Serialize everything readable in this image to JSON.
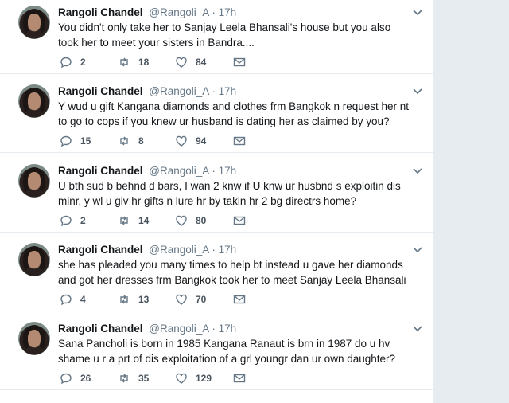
{
  "tweets": [
    {
      "name": "Rangoli Chandel",
      "handle": "@Rangoli_A",
      "dot": "·",
      "time": "17h",
      "text": "You didn't only take her to Sanjay Leela Bhansali's house but you also took her to meet your sisters in Bandra....",
      "replies": "2",
      "retweets": "18",
      "likes": "84"
    },
    {
      "name": "Rangoli Chandel",
      "handle": "@Rangoli_A",
      "dot": "·",
      "time": "17h",
      "text": "Y wud u gift Kangana diamonds and clothes frm Bangkok n request her nt to go to cops if you knew ur husband is dating her as claimed by you?",
      "replies": "15",
      "retweets": "8",
      "likes": "94"
    },
    {
      "name": "Rangoli Chandel",
      "handle": "@Rangoli_A",
      "dot": "·",
      "time": "17h",
      "text": "U bth sud b behnd d bars, I wan 2 knw if U knw ur husbnd s exploitin dis minr, y wl u giv hr gifts n lure hr by takin hr 2 bg directrs home?",
      "replies": "2",
      "retweets": "14",
      "likes": "80"
    },
    {
      "name": "Rangoli Chandel",
      "handle": "@Rangoli_A",
      "dot": "·",
      "time": "17h",
      "text": "she has pleaded you many times to help bt instead u gave her diamonds and got her dresses frm Bangkok took her to meet Sanjay Leela Bhansali",
      "replies": "4",
      "retweets": "13",
      "likes": "70"
    },
    {
      "name": "Rangoli Chandel",
      "handle": "@Rangoli_A",
      "dot": "·",
      "time": "17h",
      "text": "Sana Pancholi is born in 1985 Kangana Ranaut is brn in 1987 do u hv shame u r a prt of dis exploitation of a grl youngr dan ur own daughter?",
      "replies": "26",
      "retweets": "35",
      "likes": "129"
    }
  ],
  "icons": {
    "reply": "reply-icon",
    "retweet": "retweet-icon",
    "like": "heart-icon",
    "dm": "envelope-icon",
    "caret": "chevron-down-icon"
  },
  "colors": {
    "page_background": "#e6ecf0",
    "card": "#ffffff",
    "secondary_text": "#657786",
    "primary_text": "#14171a"
  }
}
